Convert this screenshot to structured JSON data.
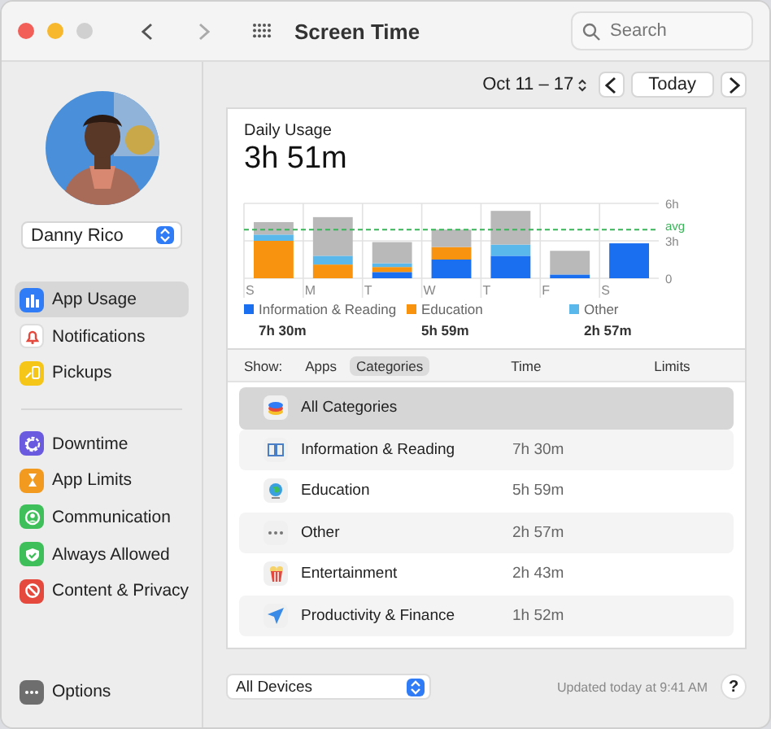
{
  "window": {
    "title": "Screen Time",
    "search": {
      "placeholder": "Search"
    }
  },
  "user": {
    "name": "Danny Rico"
  },
  "sidebar": {
    "groups": [
      [
        {
          "label": "App Usage",
          "selected": true,
          "color": "#2f7cf6"
        },
        {
          "label": "Notifications",
          "selected": false,
          "color": "#ffffff"
        },
        {
          "label": "Pickups",
          "selected": false,
          "color": "#f5c518"
        }
      ],
      [
        {
          "label": "Downtime",
          "selected": false,
          "color": "#6a5ae0"
        },
        {
          "label": "App Limits",
          "selected": false,
          "color": "#f29a1f"
        },
        {
          "label": "Communication",
          "selected": false,
          "color": "#3fbf5a"
        },
        {
          "label": "Always Allowed",
          "selected": false,
          "color": "#3fbf5a"
        },
        {
          "label": "Content & Privacy",
          "selected": false,
          "color": "#e5483c"
        }
      ]
    ],
    "options": {
      "label": "Options",
      "color": "#6e6e6e"
    }
  },
  "date_range": {
    "label": "Oct 11 – 17",
    "today": "Today"
  },
  "usage": {
    "title": "Daily Usage",
    "total": "3h 51m",
    "chart_data": {
      "type": "bar",
      "stacked": true,
      "categories": [
        "S",
        "M",
        "T",
        "W",
        "T",
        "F",
        "S"
      ],
      "ylim": [
        0,
        6
      ],
      "yticks": [
        {
          "value": 0,
          "label": "0"
        },
        {
          "value": 3,
          "label": "3h"
        },
        {
          "value": 6,
          "label": "6h"
        }
      ],
      "series": [
        {
          "name": "Information & Reading",
          "color": "#1a6ff0",
          "values": [
            0,
            0,
            0.5,
            1.5,
            1.8,
            0.3,
            2.8
          ]
        },
        {
          "name": "Education",
          "color": "#f7930f",
          "values": [
            3.0,
            1.1,
            0.4,
            1.0,
            0,
            0,
            0
          ]
        },
        {
          "name": "Other",
          "color": "#5bb8ea",
          "values": [
            0.5,
            0.7,
            0.3,
            0,
            0.9,
            0,
            0
          ]
        },
        {
          "color": "#b9b9b9",
          "values": [
            1.0,
            3.1,
            1.7,
            1.4,
            2.7,
            1.9,
            0
          ]
        }
      ],
      "ref_lines": [
        {
          "axis": "y",
          "value": 3.9,
          "label": "avg"
        }
      ]
    },
    "totals": [
      "7h 30m",
      "5h 59m",
      "2h 57m"
    ]
  },
  "table": {
    "show_label": "Show:",
    "toggle": [
      {
        "label": "Apps",
        "selected": false
      },
      {
        "label": "Categories",
        "selected": true
      }
    ],
    "columns": [
      "Time",
      "Limits"
    ],
    "rows": [
      {
        "name": "All Categories",
        "selected": true
      },
      {
        "name": "Information & Reading",
        "time": "7h 30m",
        "selected": false
      },
      {
        "name": "Education",
        "time": "5h 59m",
        "selected": false
      },
      {
        "name": "Other",
        "time": "2h 57m",
        "selected": false
      },
      {
        "name": "Entertainment",
        "time": "2h 43m",
        "selected": false
      },
      {
        "name": "Productivity & Finance",
        "time": "1h 52m",
        "selected": false
      }
    ]
  },
  "footer": {
    "device": "All Devices",
    "updated": "Updated today at 9:41 AM",
    "help": "?"
  }
}
